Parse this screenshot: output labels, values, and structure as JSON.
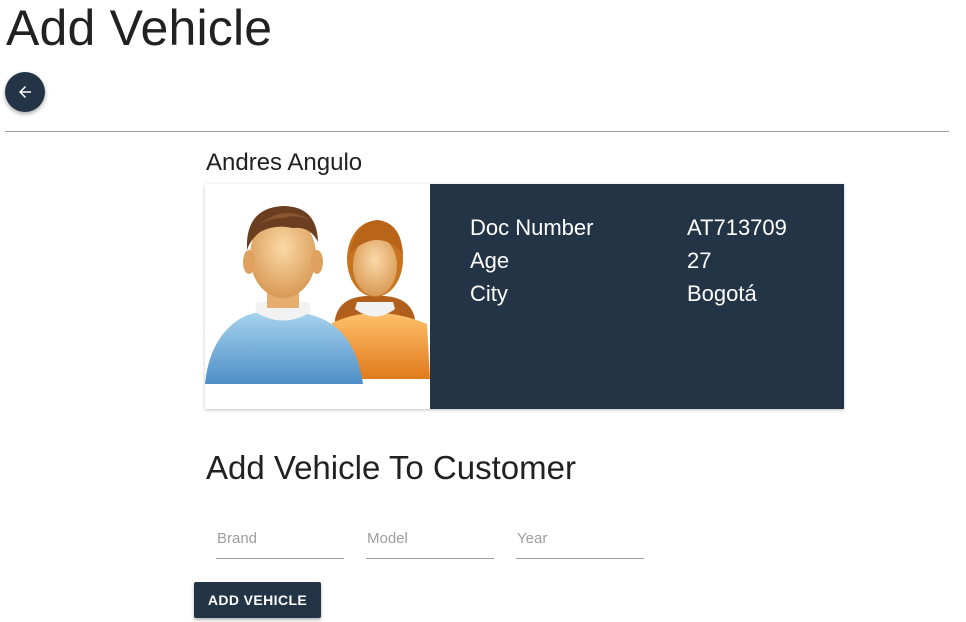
{
  "header": {
    "title": "Add Vehicle",
    "back_icon": "arrow-left-icon"
  },
  "customer": {
    "name": "Andres Angulo",
    "avatar_icon": "users-icon",
    "details": [
      {
        "label": "Doc Number",
        "value": "AT713709"
      },
      {
        "label": "Age",
        "value": "27"
      },
      {
        "label": "City",
        "value": "Bogotá"
      }
    ]
  },
  "form": {
    "title": "Add Vehicle To Customer",
    "brand_placeholder": "Brand",
    "model_placeholder": "Model",
    "year_placeholder": "Year",
    "submit_label": "ADD VEHICLE"
  },
  "colors": {
    "primary": "#233446",
    "divider": "#9e9e9e"
  }
}
